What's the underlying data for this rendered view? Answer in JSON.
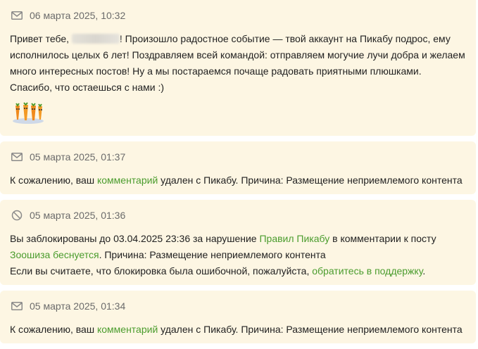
{
  "notifications": [
    {
      "icon": "mail-icon",
      "date": "06 марта 2025, 10:32",
      "text_before_name": "Привет тебе, ",
      "text_after_name": "! Произошло радостное событие — твой аккаунт на Пикабу подрос, ему исполнилось целых 6 лет! Поздравляем всей командой: отправляем могучие лучи добра и желаем много интересных постов! Ну а мы постараемся почаще радовать приятными плюшками. Спасибо, что остаешься с нами :)",
      "sticker": "carrots-sticker"
    },
    {
      "icon": "mail-icon",
      "date": "05 марта 2025, 01:37",
      "text_before_link": "К сожалению, ваш ",
      "link": "комментарий",
      "text_after_link": " удален с Пикабу. Причина: Размещение неприемлемого контента"
    },
    {
      "icon": "ban-icon",
      "date": "05 марта 2025, 01:36",
      "text_1": "Вы заблокированы до 03.04.2025 23:36 за нарушение ",
      "link_rules": "Правил Пикабу",
      "text_2": " в комментарии к посту ",
      "link_post": "Зоошиза беснуется",
      "text_3": ". Причина: Размещение неприемлемого контента",
      "text_4": "Если вы считаете, что блокировка была ошибочной, пожалуйста, ",
      "link_support": "обратитесь в поддержку",
      "text_5": "."
    },
    {
      "icon": "mail-icon",
      "date": "05 марта 2025, 01:34",
      "text_before_link": "К сожалению, ваш ",
      "link": "комментарий",
      "text_after_link": " удален с Пикабу. Причина: Размещение неприемлемого контента"
    }
  ],
  "colors": {
    "card_bg": "#fdf6e3",
    "link": "#4a9c2d",
    "date": "#6b6b6b",
    "text": "#1f1f1f"
  }
}
